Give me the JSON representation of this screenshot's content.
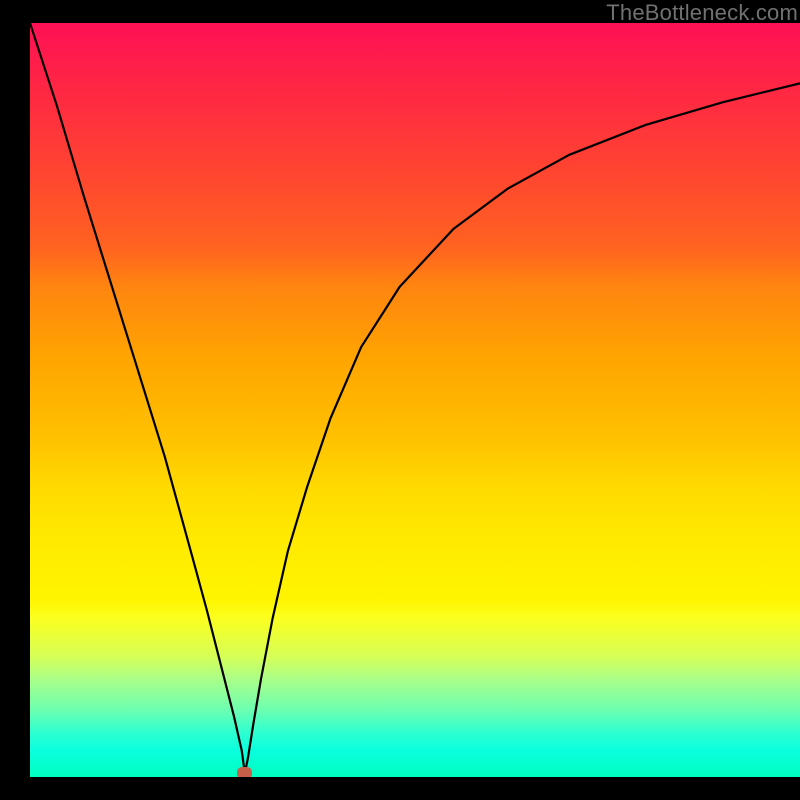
{
  "watermark": "TheBottleneck.com",
  "marker": {
    "x_pct": 27.9,
    "y_pct": 0
  },
  "chart_data": {
    "type": "line",
    "title": "",
    "xlabel": "",
    "ylabel": "",
    "xlim": [
      0,
      100
    ],
    "ylim": [
      0,
      100
    ],
    "grid": false,
    "legend": false,
    "series": [
      {
        "name": "bottleneck-curve",
        "x": [
          0,
          3.5,
          7,
          10.5,
          14,
          17.5,
          21,
          23,
          25,
          26.5,
          27.5,
          27.9,
          28.3,
          29,
          30,
          31.5,
          33.5,
          36,
          39,
          43,
          48,
          55,
          62,
          70,
          80,
          90,
          100
        ],
        "y": [
          100,
          89,
          77,
          65.5,
          54,
          42.5,
          29.5,
          22,
          14,
          8,
          3.5,
          0.5,
          2.5,
          7,
          13,
          21,
          30,
          38.5,
          47.5,
          57,
          65,
          72.7,
          78,
          82.5,
          86.5,
          89.5,
          92
        ]
      }
    ],
    "annotations": []
  }
}
